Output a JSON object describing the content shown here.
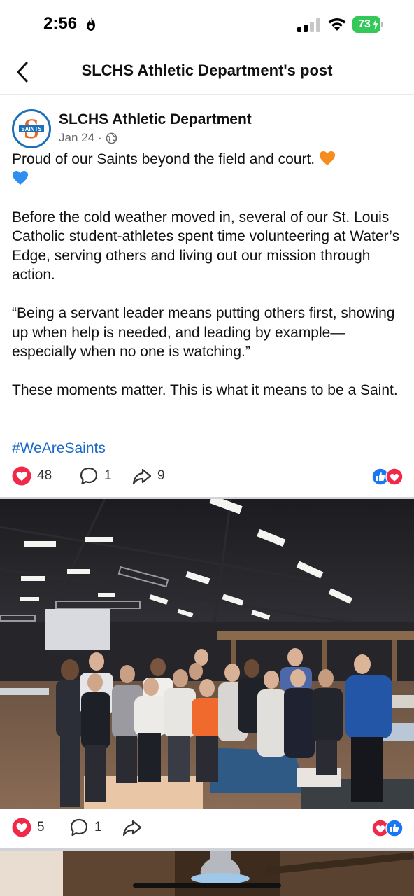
{
  "status": {
    "time": "2:56",
    "battery": "73"
  },
  "header": {
    "title": "SLCHS Athletic Department's post"
  },
  "post": {
    "author": "SLCHS Athletic Department",
    "avatar_text": "SAINTS",
    "date": "Jan 24",
    "separator": "·",
    "lines": {
      "p1": "Proud of our Saints beyond the field and court.",
      "p2": "Before the cold weather moved in, several of our St. Louis Catholic student-athletes spent time volunteering at Water’s Edge, serving others and living out our mission through action.",
      "p3": "“Being a servant leader means putting others first, showing up when help is needed, and leading by example—especially when no one is watching.”",
      "p4": "These moments matter. This is what it means to be a Saint."
    },
    "hashtag": "#WeAreSaints",
    "reactions": {
      "likes": "48",
      "comments": "1",
      "shares": "9"
    }
  },
  "photo_post": {
    "reactions": {
      "likes": "5",
      "comments": "1"
    }
  },
  "colors": {
    "accent_blue": "#1b6ac9",
    "heart_red": "#f02849",
    "like_blue": "#1877f2",
    "battery_green": "#34c759"
  }
}
